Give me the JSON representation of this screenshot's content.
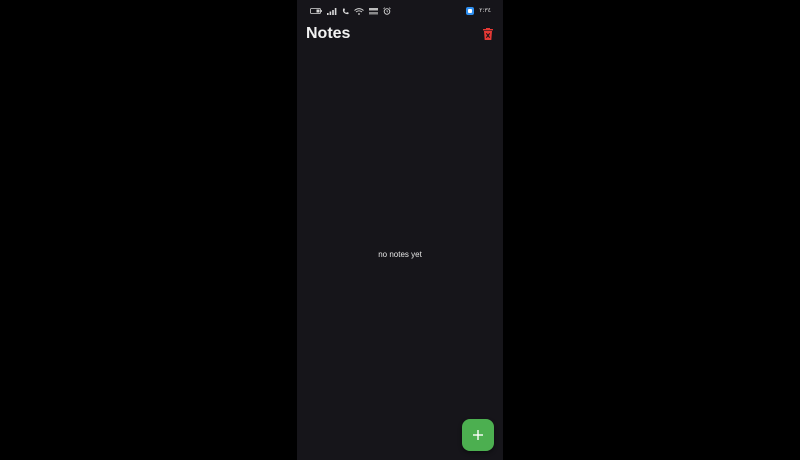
{
  "status_bar": {
    "left_icons": [
      "battery-icon",
      "signal-icon",
      "call-icon",
      "wifi-icon",
      "data-speed-icon",
      "alarm-icon"
    ],
    "right_icon": "app-notification-icon",
    "clock": "٢:٣٤"
  },
  "app_bar": {
    "title": "Notes",
    "delete_icon": "delete-all-icon"
  },
  "main": {
    "empty_message": "no notes yet"
  },
  "fab": {
    "icon": "plus-icon"
  },
  "colors": {
    "background": "#16151a",
    "accent": "#4caf50",
    "delete": "#e53935",
    "text": "#f2f2f2"
  }
}
